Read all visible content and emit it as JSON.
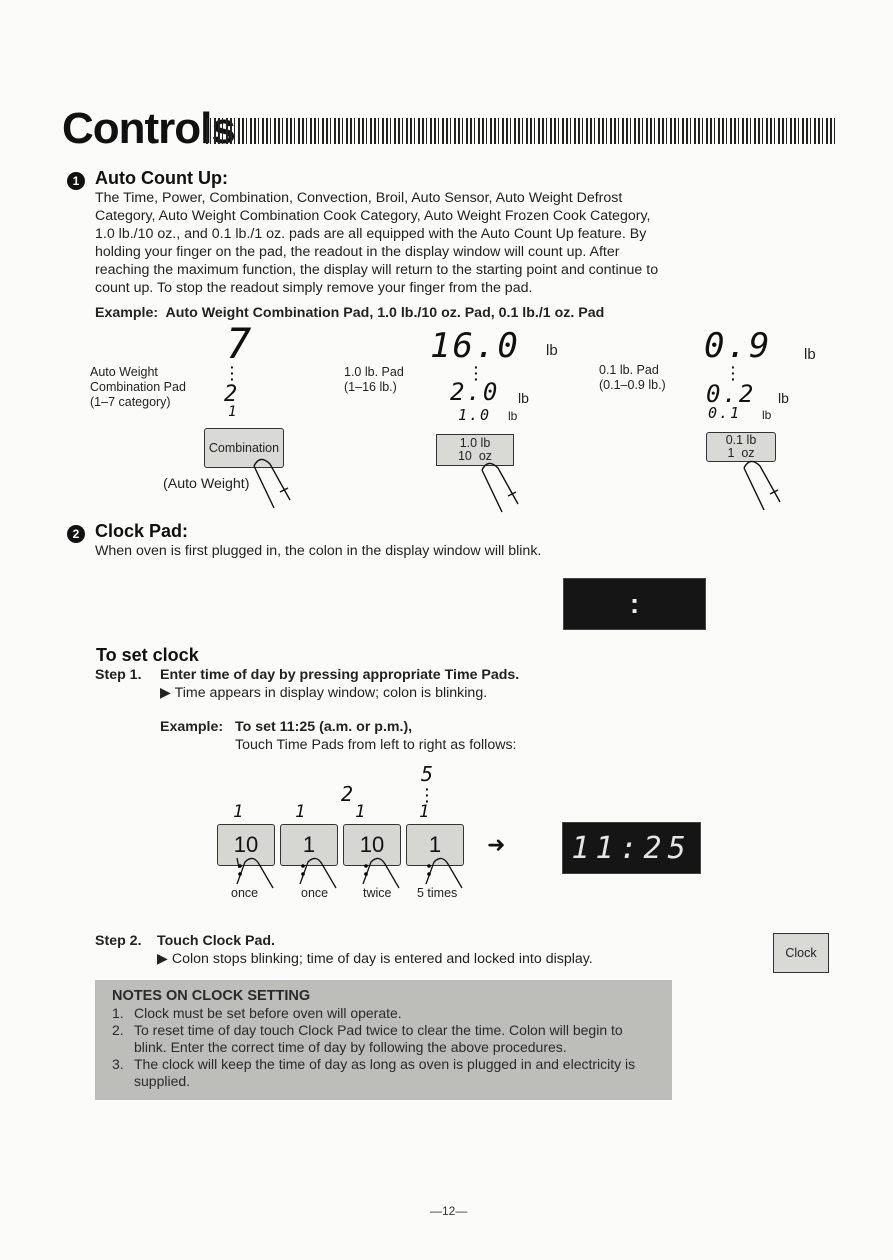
{
  "page": {
    "title": "Controls",
    "page_number": "—12—"
  },
  "section1": {
    "number": "1",
    "heading": "Auto Count Up:",
    "paragraph": [
      "The Time, Power, Combination, Convection, Broil, Auto Sensor, Auto Weight Defrost",
      "Category, Auto Weight Combination Cook Category, Auto Weight Frozen Cook Category,",
      "1.0 lb./10 oz., and 0.1 lb./1 oz. pads are all equipped with the Auto Count Up feature. By",
      "holding your finger on the pad, the readout in the display window will count up. After",
      "reaching the maximum function, the display will return to the starting point and continue to",
      "count up. To stop the readout simply remove your finger from the pad."
    ],
    "example_label": "Example:",
    "example_text": "Auto Weight Combination Pad, 1.0 lb./10 oz. Pad, 0.1 lb./1 oz. Pad",
    "examples": [
      {
        "label_lines": [
          "Auto Weight",
          "Combination Pad",
          "(1–7 category)"
        ],
        "readouts": [
          "7",
          "2",
          "1"
        ],
        "unit": "",
        "pad_lines": [
          "Combination"
        ],
        "caption": "(Auto Weight)"
      },
      {
        "label_lines": [
          "1.0 lb. Pad",
          "(1–16 lb.)"
        ],
        "readouts": [
          "16.0",
          "2.0",
          "1.0"
        ],
        "unit": "lb",
        "pad_lines": [
          "1.0 lb",
          "10  oz"
        ],
        "caption": ""
      },
      {
        "label_lines": [
          "0.1 lb. Pad",
          "(0.1–0.9 lb.)"
        ],
        "readouts": [
          "0.9",
          "0.2",
          "0.1"
        ],
        "unit": "lb",
        "pad_lines": [
          "0.1 lb",
          "1  oz"
        ],
        "caption": ""
      }
    ]
  },
  "section2": {
    "number": "2",
    "heading": "Clock Pad:",
    "intro": "When oven is first plugged in, the colon in the display window will blink.",
    "blink_display": ":",
    "subheading": "To set clock",
    "step1": {
      "label": "Step 1.",
      "title": "Enter time of day by pressing appropriate Time Pads.",
      "result": "Time appears in display window; colon is blinking.",
      "example_label": "Example:",
      "example_title": "To set 11:25 (a.m. or p.m.),",
      "example_sub": "Touch Time Pads from left to right as follows:",
      "pads": [
        {
          "label": "10",
          "readout_top": "",
          "readout": "1",
          "times": "once"
        },
        {
          "label": "1",
          "readout_top": "",
          "readout": "1",
          "times": "once"
        },
        {
          "label": "10",
          "readout_top": "2",
          "readout": "1",
          "times": "twice"
        },
        {
          "label": "1",
          "readout_top": "5",
          "readout": "1",
          "times": "5 times"
        }
      ],
      "arrow": "➜",
      "display": "11:25"
    },
    "step2": {
      "label": "Step 2.",
      "title": "Touch Clock Pad.",
      "result": "Colon stops blinking; time of day is entered and locked into display.",
      "pad_label": "Clock"
    },
    "notes": {
      "title": "NOTES ON CLOCK SETTING",
      "items": [
        {
          "num": "1.",
          "lines": [
            "Clock must be set before oven will operate."
          ]
        },
        {
          "num": "2.",
          "lines": [
            "To reset time of day touch Clock Pad twice to clear the time. Colon will begin to",
            "blink. Enter the correct time of day by following the above procedures."
          ]
        },
        {
          "num": "3.",
          "lines": [
            "The clock will keep the time of day as long as oven is plugged in and electricity is",
            "supplied."
          ]
        }
      ]
    }
  },
  "icons": {
    "bullet": "▶"
  }
}
